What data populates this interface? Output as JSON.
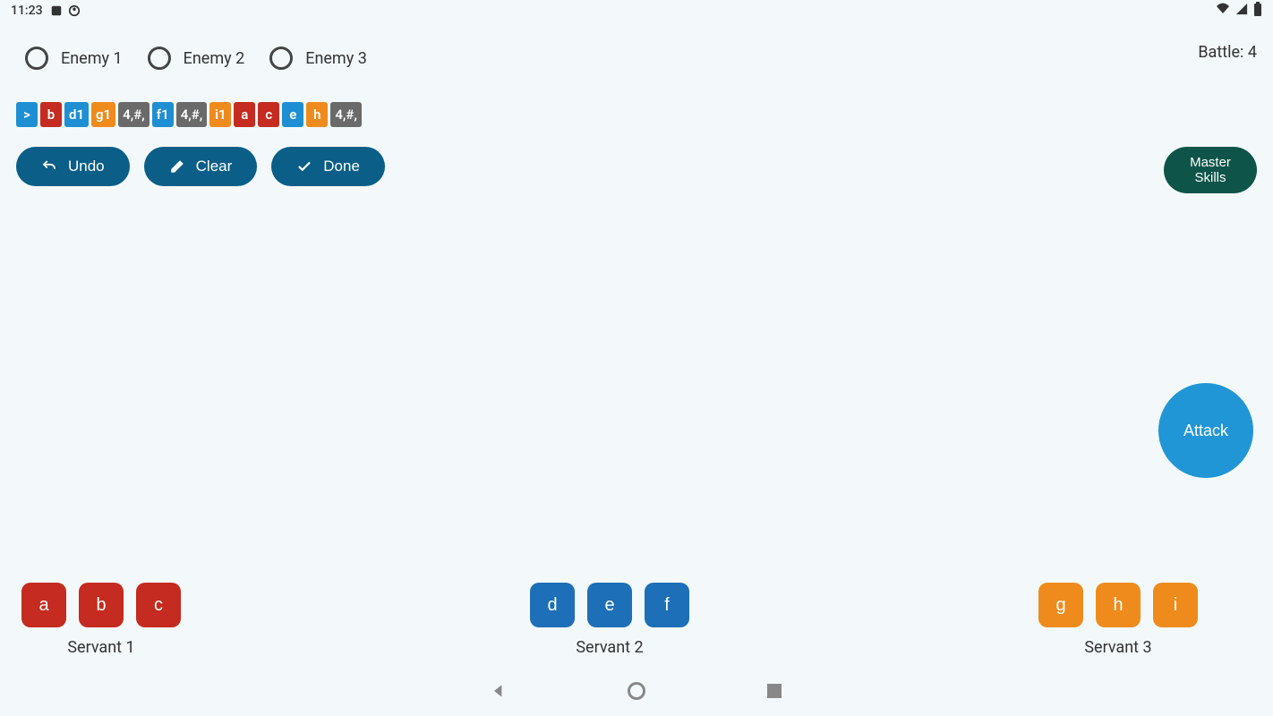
{
  "status": {
    "time": "11:23",
    "left_icons": [
      "app-icon",
      "profile-icon"
    ],
    "right_icons": [
      "wifi-icon",
      "signal-icon",
      "battery-icon"
    ]
  },
  "enemies": [
    {
      "label": "Enemy 1",
      "checked": false
    },
    {
      "label": "Enemy 2",
      "checked": false
    },
    {
      "label": "Enemy 3",
      "checked": false
    }
  ],
  "battle": {
    "label": "Battle:",
    "value": "4"
  },
  "sequence": [
    {
      "text": ">",
      "color": "blue"
    },
    {
      "text": "b",
      "color": "red"
    },
    {
      "text": "d1",
      "color": "blue"
    },
    {
      "text": "g1",
      "color": "orange"
    },
    {
      "text": "4,#,",
      "color": "gray"
    },
    {
      "text": "f1",
      "color": "blue"
    },
    {
      "text": "4,#,",
      "color": "gray"
    },
    {
      "text": "i1",
      "color": "orange"
    },
    {
      "text": "a",
      "color": "red"
    },
    {
      "text": "c",
      "color": "red"
    },
    {
      "text": "e",
      "color": "blue"
    },
    {
      "text": "h",
      "color": "orange"
    },
    {
      "text": "4,#,",
      "color": "gray"
    }
  ],
  "actions": {
    "undo": "Undo",
    "clear": "Clear",
    "done": "Done"
  },
  "master_skills": {
    "line1": "Master",
    "line2": "Skills"
  },
  "attack": "Attack",
  "servants": [
    {
      "label": "Servant 1",
      "color": "red",
      "skills": [
        "a",
        "b",
        "c"
      ]
    },
    {
      "label": "Servant 2",
      "color": "blue",
      "skills": [
        "d",
        "e",
        "f"
      ]
    },
    {
      "label": "Servant 3",
      "color": "orange",
      "skills": [
        "g",
        "h",
        "i"
      ]
    }
  ],
  "navbar": [
    "back",
    "home",
    "recents"
  ]
}
